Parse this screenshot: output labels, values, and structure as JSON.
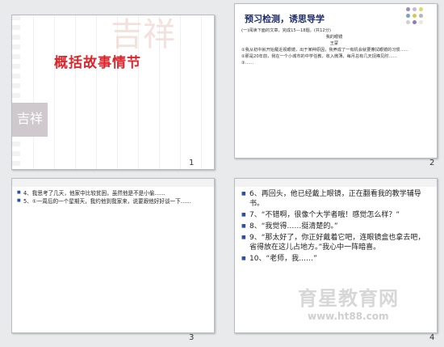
{
  "slides": [
    {
      "number": "1",
      "title": "概括故事情节",
      "seal_big": "吉祥",
      "seal_small": "吉祥"
    },
    {
      "number": "2",
      "title": "预习检测，诱思导学",
      "lines": [
        "(一)阅读下面的文章，完成15—18题。(共12分)",
        "我的眼镜",
        "王蒙",
        "①我从初中就开始戴近视眼镜，出于某种原因，我养成了一有机会就要擦拭眼镜的习惯……",
        "②那是20年前，我在一个小城市的中学任教，收入微薄，每月总有几天捉襟见肘……",
        "③……"
      ]
    },
    {
      "number": "3",
      "items": [
        "4、我思考了几天，他家中比较贫困，虽然他是不是小偷……",
        "5、①一周后的一个星期天，我约他到我家来，说要跟他好好谈一下……"
      ]
    },
    {
      "number": "4",
      "items": [
        "6、再回头，他已经戴上眼镜，正在翻看我的教学辅导书。",
        "7、“不错啊，很像个大学者哦！感觉怎么样？”",
        "8、“我觉得……挺清楚的。”",
        "9、“那太好了，你正好戴着它吧，连眼镜盒也拿去吧，省得放在这儿占地方。”我心中一阵暗喜。",
        "10、“老师，我……”"
      ],
      "watermark": "育星教育网",
      "watermark_url": "www.ht88.com"
    }
  ],
  "colors": {
    "title_red": "#e0242b",
    "bullet_blue": "#2b4fa2",
    "header_navy": "#1f2d6b"
  }
}
